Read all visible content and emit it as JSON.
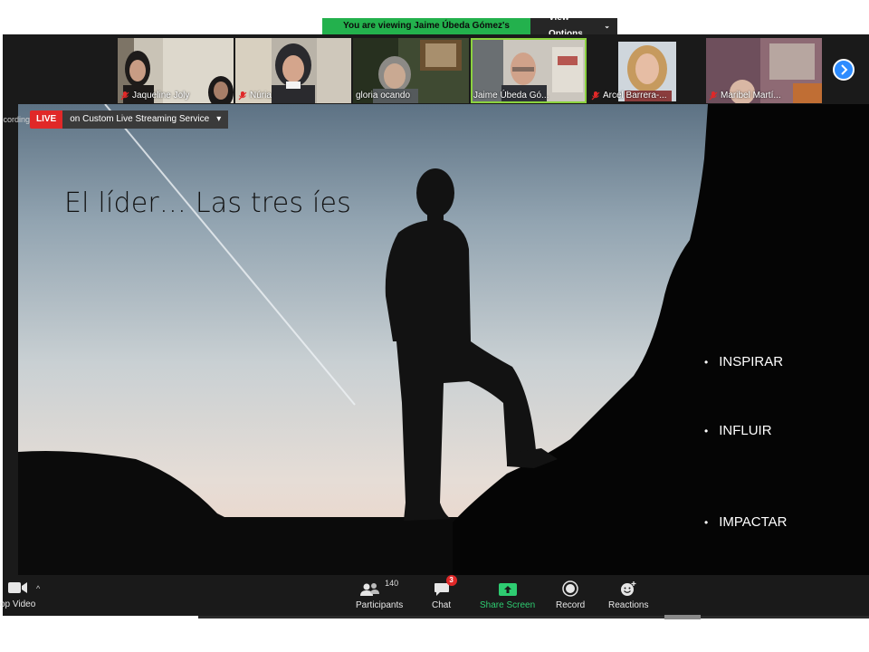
{
  "banner": {
    "viewing_text": "You are viewing Jaime Úbeda Gómez's screen",
    "options_label": "View Options",
    "colors": {
      "viewing_bg": "#23b14d",
      "options_bg": "#262626"
    }
  },
  "participants": [
    {
      "name": "Jaqueline Joly",
      "muted": true
    },
    {
      "name": "Núria",
      "muted": true
    },
    {
      "name": "gloria ocando",
      "muted": false
    },
    {
      "name": "Jaime Úbeda Gó...",
      "muted": false,
      "active": true
    },
    {
      "name": "Arcel Barrera-...",
      "muted": true
    },
    {
      "name": "Maribel Martí...",
      "muted": true
    }
  ],
  "next_icon": "chevron-right-icon",
  "live": {
    "recording_text": "Recording",
    "badge": "LIVE",
    "service": "on Custom Live Streaming Service"
  },
  "slide": {
    "title": "El líder… Las tres íes",
    "bullets": [
      "INSPIRAR",
      "INFLUIR",
      "IMPACTAR"
    ]
  },
  "toolbar": {
    "stop_video": "op Video",
    "participants_label": "Participants",
    "participants_count": "140",
    "chat_label": "Chat",
    "chat_badge": "3",
    "share_label": "Share Screen",
    "record_label": "Record",
    "reactions_label": "Reactions"
  },
  "colors": {
    "accent_blue": "#2d8cff",
    "share_green": "#2ecc71",
    "live_red": "#e02828",
    "active_outline": "#8bd23e"
  }
}
